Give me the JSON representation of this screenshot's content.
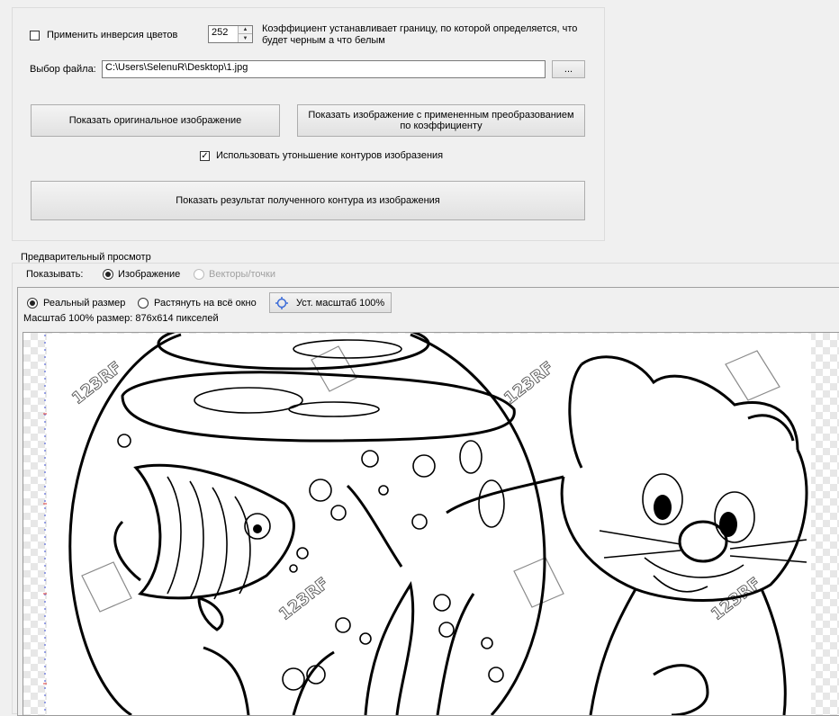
{
  "settings": {
    "invert_checkbox": {
      "label": "Применить инверсия цветов",
      "checked": false
    },
    "threshold": {
      "value": "252",
      "description": "Коэффициент устанавливает границу, по которой определяется, что будет  черным а что белым"
    },
    "file": {
      "label": "Выбор файла:",
      "path": "C:\\Users\\SelenuR\\Desktop\\1.jpg",
      "browse_label": "..."
    },
    "buttons": {
      "show_original": "Показать оригинальное изображение",
      "show_converted": "Показать изображение с примененным преобразованием по коэффициенту",
      "show_contour": "Показать результат полученного контура из изображения"
    },
    "thinning_checkbox": {
      "label": "Использовать утоньшение контуров изобразения",
      "checked": true,
      "mark": "✓"
    }
  },
  "preview": {
    "title": "Предварительный просмотр",
    "show_label": "Показывать:",
    "mode_image": "Изображение",
    "mode_vectors": "Векторы/точки",
    "size_real": "Реальный размер",
    "size_stretch": "Растянуть на всё окно",
    "zoom_button": "Уст. масштаб 100%",
    "scale_info": "Масштаб 100% размер: 876x614 пикселей",
    "watermark": "123RF"
  }
}
